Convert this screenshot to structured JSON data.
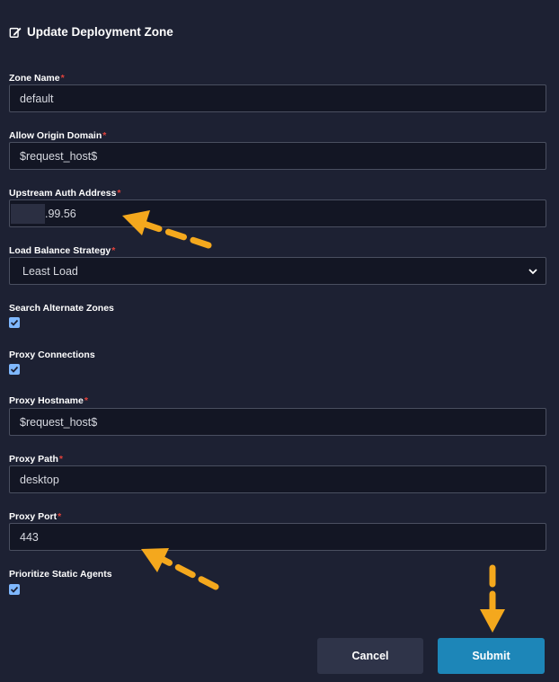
{
  "header": {
    "title": "Update Deployment Zone",
    "icon": "edit-icon"
  },
  "fields": {
    "zone_name": {
      "label": "Zone Name",
      "required_mark": "*",
      "value": "default"
    },
    "allow_origin_domain": {
      "label": "Allow Origin Domain",
      "required_mark": "*",
      "value": "$request_host$"
    },
    "upstream_auth_address": {
      "label": "Upstream Auth Address",
      "required_mark": "*",
      "value": ".99.56"
    },
    "load_balance_strategy": {
      "label": "Load Balance Strategy",
      "required_mark": "*",
      "value": "Least Load"
    },
    "search_alternate_zones": {
      "label": "Search Alternate Zones",
      "checked": true
    },
    "proxy_connections": {
      "label": "Proxy Connections",
      "checked": true
    },
    "proxy_hostname": {
      "label": "Proxy Hostname",
      "required_mark": "*",
      "value": "$request_host$"
    },
    "proxy_path": {
      "label": "Proxy Path",
      "required_mark": "*",
      "value": "desktop"
    },
    "proxy_port": {
      "label": "Proxy Port",
      "required_mark": "*",
      "value": "443"
    },
    "prioritize_static_agents": {
      "label": "Prioritize Static Agents",
      "checked": true
    }
  },
  "actions": {
    "cancel_label": "Cancel",
    "submit_label": "Submit"
  },
  "colors": {
    "background": "#1d2133",
    "input_bg": "#131624",
    "submit": "#1d86b8",
    "cancel": "#2f3449",
    "required": "#e0413b",
    "checkbox": "#7fb8ff",
    "annotation_arrow": "#f4a81d"
  }
}
